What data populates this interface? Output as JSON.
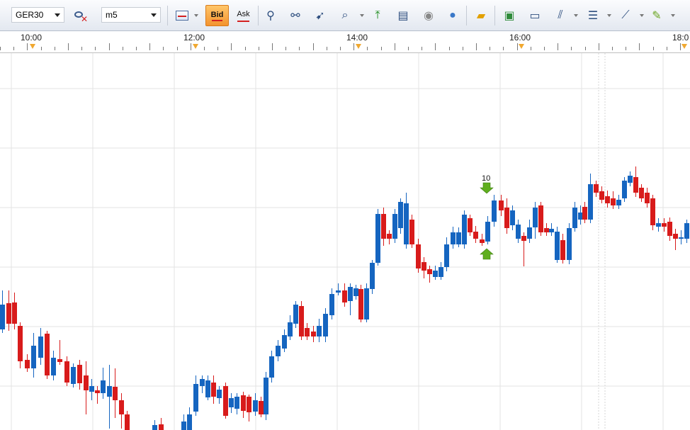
{
  "toolbar": {
    "symbol": "GER30",
    "timeframe": "m5",
    "bid_label": "Bid",
    "ask_label": "Ask",
    "icons": [
      "remove-symbol-icon",
      "chart-type-icon",
      "crosshair-icon",
      "link-icon",
      "cursor-icon",
      "zoom-icon",
      "autoscroll-icon",
      "screenshot-icon",
      "eye-icon",
      "globe-icon",
      "ruler-icon",
      "image-icon",
      "window-icon",
      "fork-icon",
      "lines-icon",
      "trendline-icon",
      "pencil-icon"
    ]
  },
  "time_axis": {
    "labels": [
      "10:00",
      "12:00",
      "14:00",
      "16:00",
      "18:0"
    ]
  },
  "trade": {
    "label": "10"
  },
  "colors": {
    "bull": "#1565c0",
    "bear": "#d81b1b",
    "grid": "#e3e3e3",
    "marker": "#f0a830",
    "arrow": "#5fae1e"
  }
}
